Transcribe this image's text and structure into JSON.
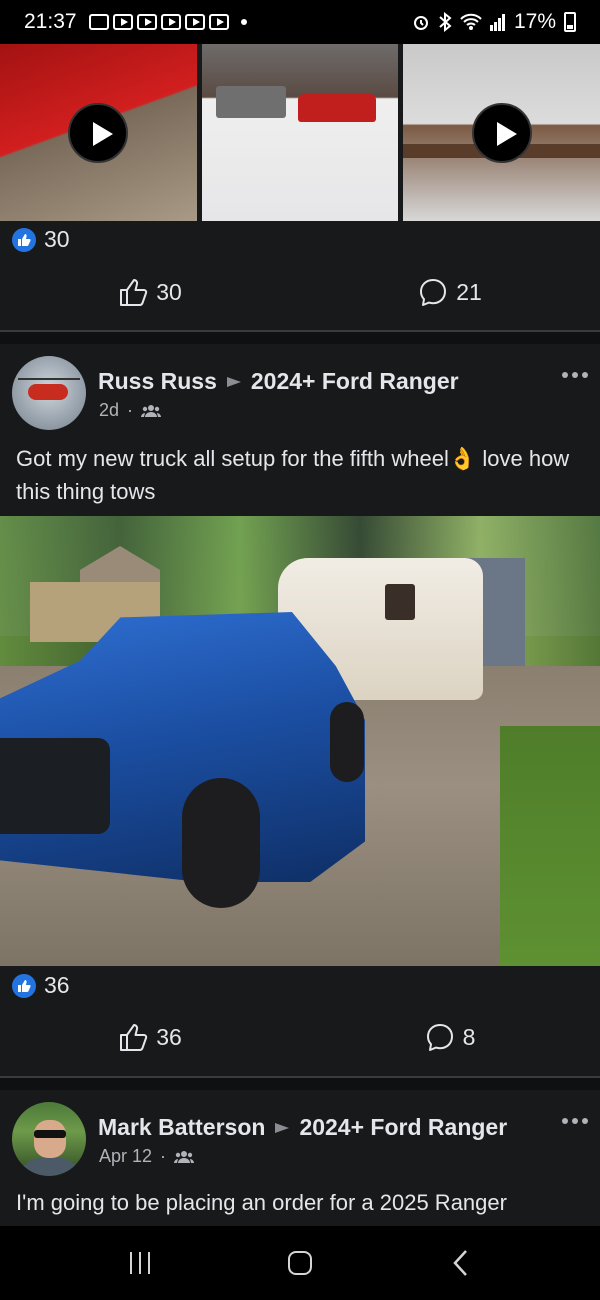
{
  "status_bar": {
    "time": "21:37",
    "battery": "17%",
    "icons": [
      "gallery-icon",
      "youtube-icon",
      "youtube-icon",
      "youtube-icon",
      "youtube-icon",
      "youtube-icon",
      "dot-icon",
      "alarm-icon",
      "bluetooth-icon",
      "wifi-icon",
      "signal-icon",
      "battery-icon"
    ]
  },
  "prev_post": {
    "reaction_count": "30",
    "like_count": "30",
    "comment_count": "21"
  },
  "post1": {
    "author": "Russ Russ",
    "group": "2024+ Ford Ranger",
    "time": "2d",
    "text": "Got my new truck all setup for the fifth wheel👌 love how this thing tows",
    "reaction_count": "36",
    "like_count": "36",
    "comment_count": "8"
  },
  "post2": {
    "author": "Mark Batterson",
    "group": "2024+ Ford Ranger",
    "time": "Apr 12",
    "text": "I'm going to be placing an order for a 2025 Ranger"
  },
  "colors": {
    "background": "#18191a",
    "like_blue": "#2374e1",
    "text_primary": "#e4e6eb",
    "text_secondary": "#b0b3b8"
  }
}
